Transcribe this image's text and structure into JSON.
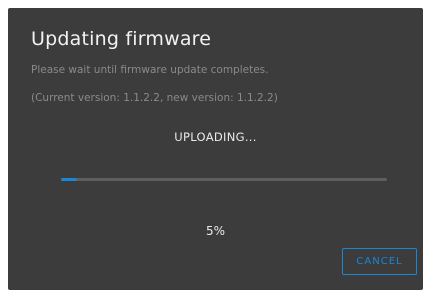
{
  "dialog": {
    "title": "Updating firmware",
    "description": "Please wait until firmware update completes.",
    "version_info": "(Current version: 1.1.2.2, new version: 1.1.2.2)",
    "status": "UPLOADING...",
    "progress_fraction": 0.05,
    "progress_text": "5%",
    "cancel_label": "CANCEL"
  },
  "colors": {
    "dialog_background": "#3c3c3c",
    "accent": "#1a86d6",
    "track": "#5e5e5e",
    "secondary_text": "#8a8a8a",
    "primary_text": "#f2f2f2"
  }
}
